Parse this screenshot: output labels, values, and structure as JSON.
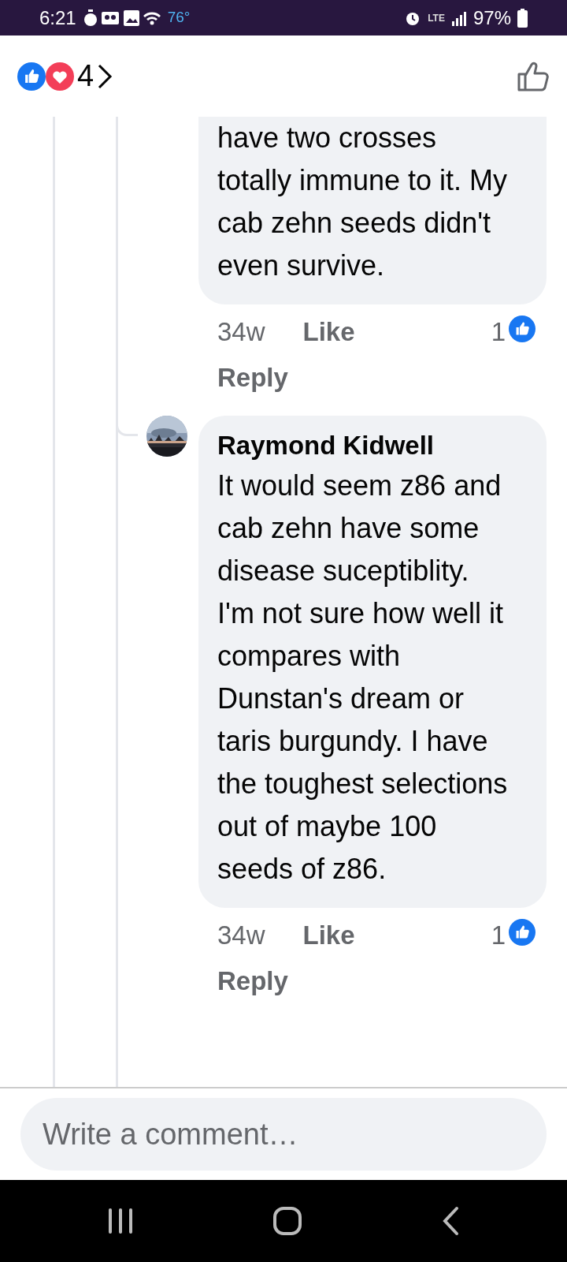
{
  "status_bar": {
    "time": "6:21",
    "temperature": "76°",
    "network": "LTE",
    "battery": "97%"
  },
  "header": {
    "reaction_count": "4"
  },
  "comments": [
    {
      "text": "have two crosses totally immune to it. My cab zehn seeds didn't even survive.",
      "time": "34w",
      "like": "Like",
      "reply": "Reply",
      "likes": "1"
    },
    {
      "author": "Raymond Kidwell",
      "text": "It would seem z86 and cab zehn have some disease suceptiblity. I'm not sure how well it compares with Dunstan's dream or taris burgundy. I have the toughest selections out of maybe 100 seeds of z86.",
      "time": "34w",
      "like": "Like",
      "reply": "Reply",
      "likes": "1"
    }
  ],
  "composer": {
    "placeholder": "Write a comment…"
  }
}
